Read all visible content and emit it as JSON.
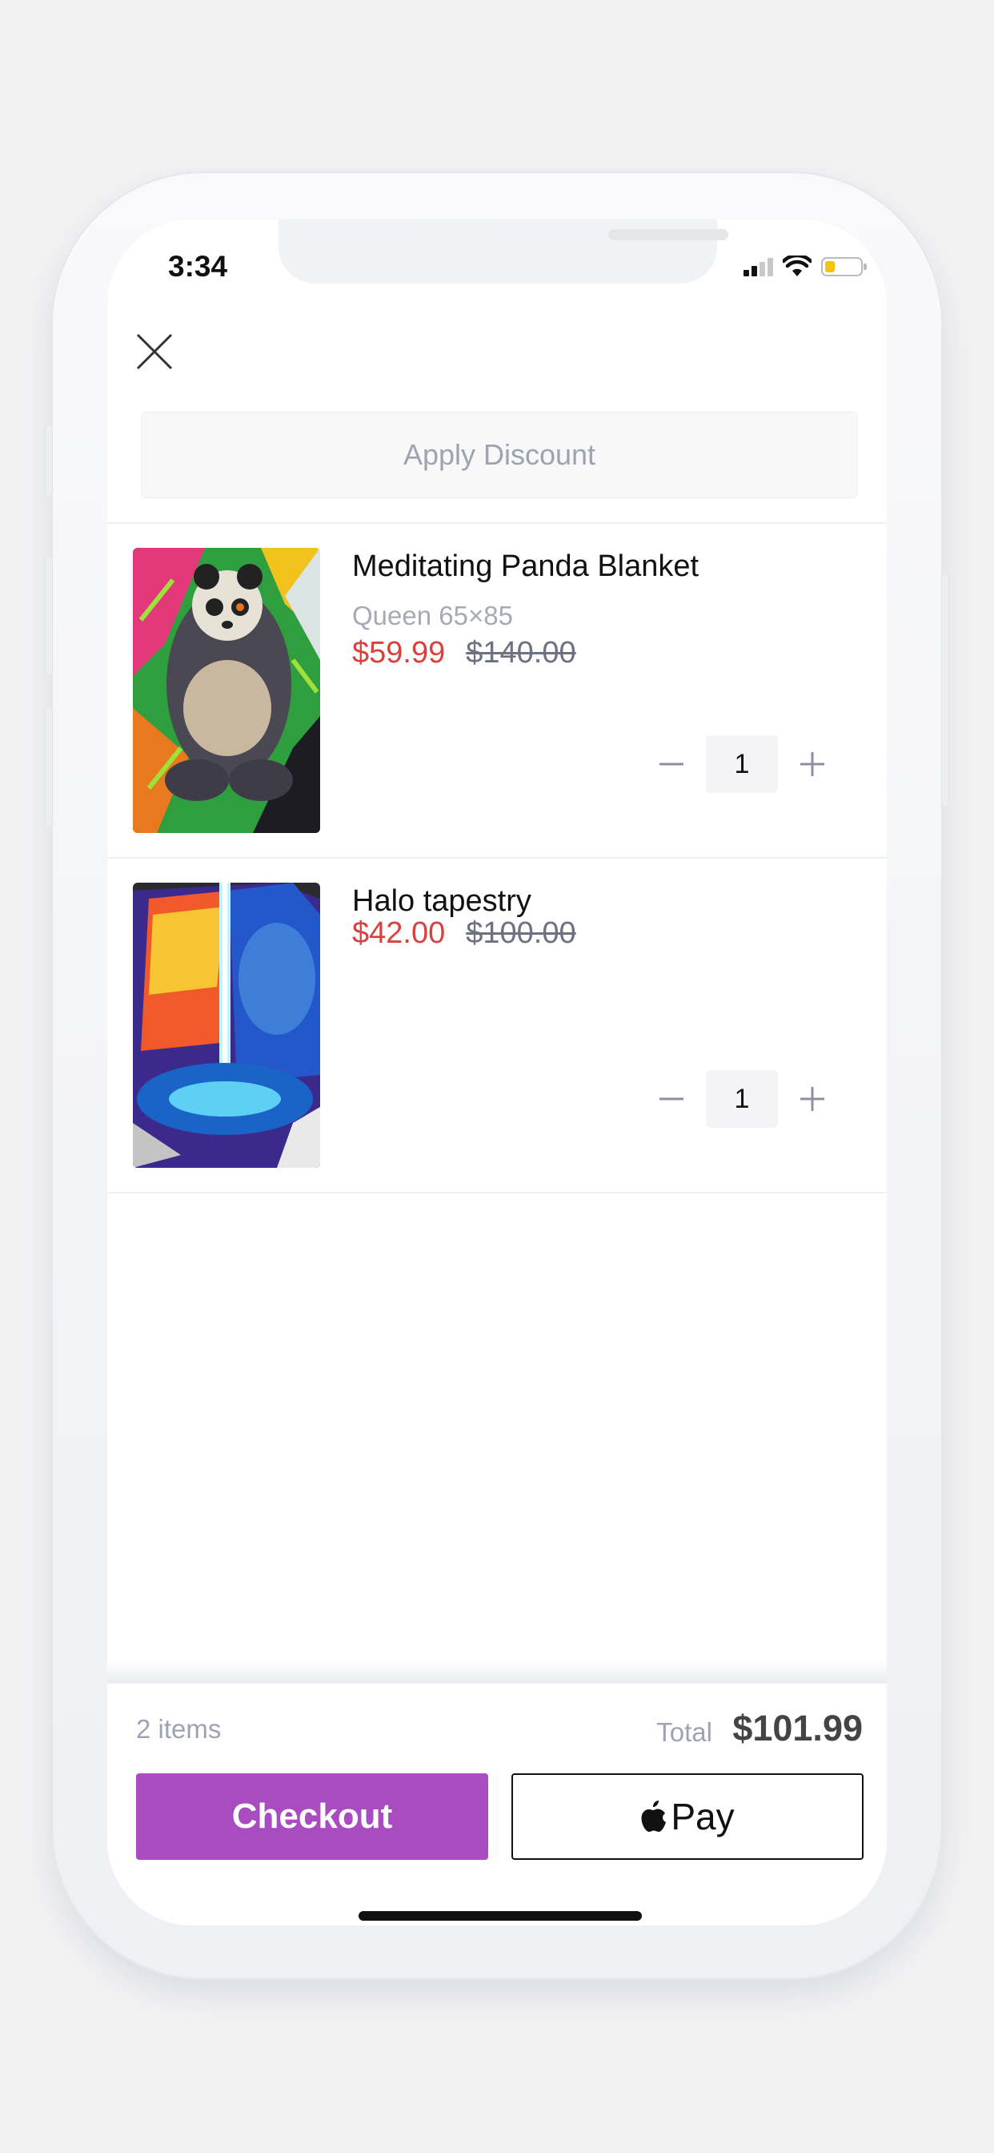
{
  "status_bar": {
    "time": "3:34"
  },
  "header": {
    "apply_discount_label": "Apply Discount"
  },
  "cart": {
    "items": [
      {
        "title": "Meditating Panda Blanket",
        "variant": "Queen 65×85",
        "sale_price": "$59.99",
        "original_price": "$140.00",
        "quantity": "1"
      },
      {
        "title": "Halo tapestry",
        "variant": "",
        "sale_price": "$42.00",
        "original_price": "$100.00",
        "quantity": "1"
      }
    ]
  },
  "summary": {
    "item_count": "2 items",
    "total_label": "Total",
    "total_value": "$101.99"
  },
  "actions": {
    "checkout_label": "Checkout",
    "apple_pay_label": "Pay"
  },
  "colors": {
    "accent": "#a94bc1",
    "sale_price": "#d9413e",
    "muted_text": "#9ea3b3"
  },
  "icons": {
    "close": "close-icon",
    "minus": "minus-icon",
    "plus": "plus-icon",
    "apple": "apple-logo-icon"
  }
}
